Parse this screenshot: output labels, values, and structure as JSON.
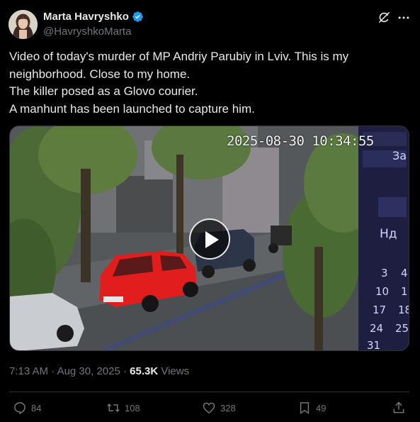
{
  "author": {
    "display_name": "Marta Havryshko",
    "handle": "@HavryshkoMarta",
    "verified": true
  },
  "tweet": {
    "lines": [
      "Video of today's murder of MP Andriy Parubiy in Lviv. This is my",
      "neighborhood. Close to my home.",
      "The killer posed as a Glovo courier.",
      "A manhunt has been launched to capture him."
    ]
  },
  "media": {
    "type": "video",
    "overlay_timestamp": "2025-08-30 10:34:55",
    "sign_texts": [
      "За",
      "Нд",
      "3",
      "10",
      "17",
      "24",
      "31",
      "4",
      "1",
      "18",
      "25"
    ]
  },
  "meta": {
    "time": "7:13 AM",
    "separator": " · ",
    "date": "Aug 30, 2025",
    "views_count": "65.3K",
    "views_label": "Views"
  },
  "actions": {
    "replies": "84",
    "reposts": "108",
    "likes": "328",
    "bookmarks": "49"
  },
  "icons": [
    "verified-icon",
    "grok-icon",
    "more-icon",
    "play-icon",
    "reply-icon",
    "repost-icon",
    "like-icon",
    "bookmark-icon",
    "share-icon"
  ],
  "colors": {
    "background": "#000000",
    "text": "#e7e9ea",
    "secondary": "#71767b",
    "verified": "#1d9bf0",
    "car": "#e11d1d"
  }
}
